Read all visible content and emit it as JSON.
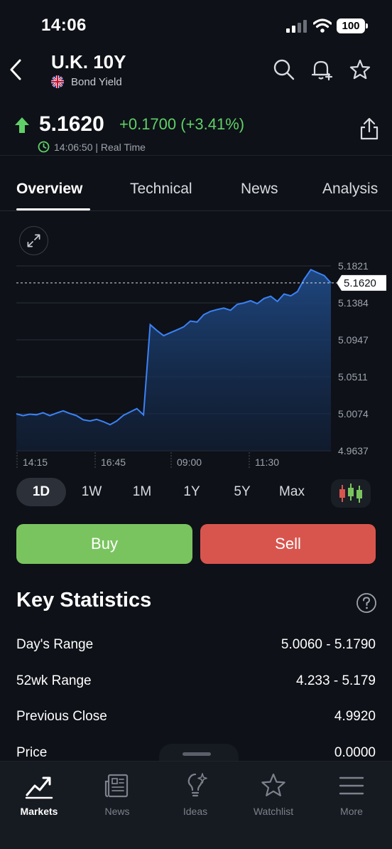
{
  "status": {
    "time": "14:06",
    "battery": "100"
  },
  "header": {
    "title": "U.K. 10Y",
    "subtitle": "Bond Yield"
  },
  "quote": {
    "price": "5.1620",
    "change": "+0.1700 (+3.41%)",
    "timestamp": "14:06:50 | Real Time",
    "accent_up": "#5fd068"
  },
  "tabs": [
    {
      "label": "Overview"
    },
    {
      "label": "Technical"
    },
    {
      "label": "News"
    },
    {
      "label": "Analysis"
    }
  ],
  "chart_data": {
    "type": "area",
    "y_ticks": [
      "5.1821",
      "5.1384",
      "5.0947",
      "5.0511",
      "5.0074",
      "4.9637"
    ],
    "ylim": [
      4.9637,
      5.1821
    ],
    "x_ticks": [
      "14:15",
      "16:45",
      "09:00",
      "11:30"
    ],
    "current_value": "5.1620",
    "series": [
      {
        "values": [
          5.0074,
          5.0052,
          5.007,
          5.0063,
          5.0087,
          5.0052,
          5.0083,
          5.0109,
          5.0078,
          5.0052,
          5.0003,
          4.999,
          5.0008,
          4.9981,
          4.9946,
          4.999,
          5.0056,
          5.0096,
          5.0135,
          5.0061,
          5.1127,
          5.1058,
          5.0997,
          5.1032,
          5.1066,
          5.1101,
          5.117,
          5.1158,
          5.1245,
          5.1284,
          5.1306,
          5.1323,
          5.1297,
          5.1367,
          5.1384,
          5.141,
          5.1376,
          5.1436,
          5.1463,
          5.1402,
          5.1489,
          5.1467,
          5.1519,
          5.1663,
          5.1777,
          5.1741,
          5.1707,
          5.162
        ],
        "color": "#3b82f6"
      }
    ]
  },
  "ranges": [
    {
      "label": "1D"
    },
    {
      "label": "1W"
    },
    {
      "label": "1M"
    },
    {
      "label": "1Y"
    },
    {
      "label": "5Y"
    },
    {
      "label": "Max"
    }
  ],
  "actions": {
    "buy": "Buy",
    "sell": "Sell",
    "buy_color": "#7ac45f",
    "sell_color": "#d8554e"
  },
  "stats": {
    "title": "Key Statistics",
    "rows": [
      {
        "label": "Day's Range",
        "value": "5.0060 - 5.1790"
      },
      {
        "label": "52wk Range",
        "value": "4.233 - 5.179"
      },
      {
        "label": "Previous Close",
        "value": "4.9920"
      },
      {
        "label": "Price",
        "value": "0.0000"
      }
    ]
  },
  "nav": [
    {
      "label": "Markets",
      "icon": "markets-chart-icon"
    },
    {
      "label": "News",
      "icon": "newspaper-icon"
    },
    {
      "label": "Ideas",
      "icon": "lightbulb-icon"
    },
    {
      "label": "Watchlist",
      "icon": "star-icon"
    },
    {
      "label": "More",
      "icon": "menu-icon"
    }
  ]
}
